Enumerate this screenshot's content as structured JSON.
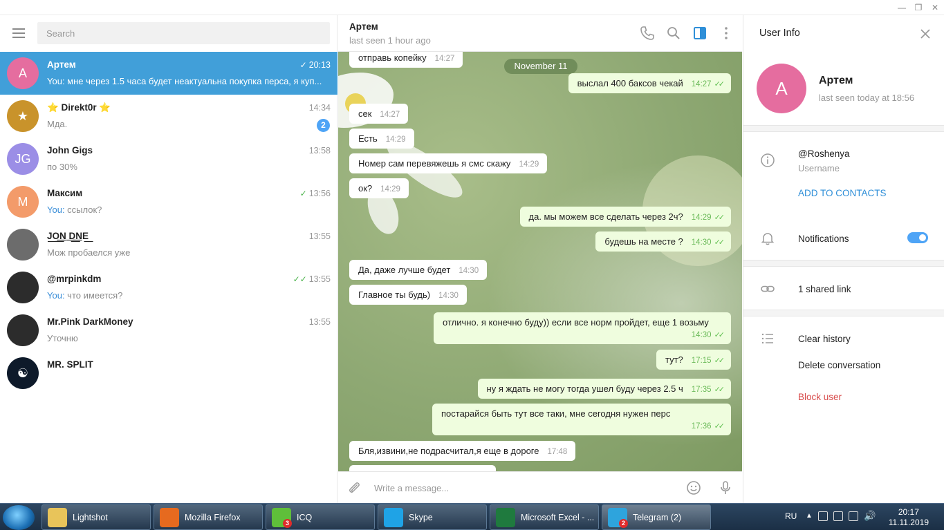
{
  "window": {
    "minimize": "—",
    "restore": "❐",
    "close": "✕"
  },
  "search": {
    "placeholder": "Search"
  },
  "chats": [
    {
      "name": "Артем",
      "time": "20:13",
      "you": "You:",
      "text": " мне через 1.5 часа будет неактуальна покупка перса, я куп...",
      "avatar": "A",
      "avatar_color": "#e56d9f",
      "read": "single"
    },
    {
      "name": "⭐ Direkt0r ⭐",
      "time": "14:34",
      "you": "",
      "text": "Мда.",
      "avatar": "★",
      "avatar_color": "#c9932b",
      "unread": "2"
    },
    {
      "name": "John Gigs",
      "time": "13:58",
      "you": "",
      "text": "по 30%",
      "avatar": "JG",
      "avatar_color": "#9b8ee6"
    },
    {
      "name": "Максим",
      "time": "13:56",
      "you": "You:",
      "text": " ссылок?",
      "avatar": "M",
      "avatar_color": "#f39b6a",
      "read": "single"
    },
    {
      "name": "J͟O͟͟N ͟D͟͟NE͟",
      "time": "13:55",
      "you": "",
      "text": "Мож пробаелся уже",
      "avatar": "",
      "avatar_color": "#6c6c6c"
    },
    {
      "name": "@mrpinkdm",
      "time": "13:55",
      "you": "You:",
      "text": " что имеется?",
      "avatar": "",
      "avatar_color": "#2c2c2c",
      "read": "double"
    },
    {
      "name": "Mr.Pink DarkMoney",
      "time": "13:55",
      "you": "",
      "text": "Уточню",
      "avatar": "",
      "avatar_color": "#2c2c2c"
    },
    {
      "name": "MR. SPLIT",
      "time": "",
      "you": "",
      "text": "",
      "avatar": "☯",
      "avatar_color": "#0e1a2a"
    }
  ],
  "chat_header": {
    "name": "Артем",
    "status": "last seen 1 hour ago"
  },
  "date_pill": "November 11",
  "messages": [
    {
      "dir": "in",
      "text": "отправь копейку",
      "time": "14:27"
    },
    {
      "dir": "out",
      "text": "выслал 400 баксов чекай",
      "time": "14:27"
    },
    {
      "dir": "in",
      "text": "сек",
      "time": "14:27"
    },
    {
      "dir": "in",
      "text": "Есть",
      "time": "14:29"
    },
    {
      "dir": "in",
      "text": "Номер сам перевяжешь я смс скажу",
      "time": "14:29"
    },
    {
      "dir": "in",
      "text": "ок?",
      "time": "14:29"
    },
    {
      "dir": "out",
      "text": "да. мы можем все сделать через 2ч?",
      "time": "14:29"
    },
    {
      "dir": "out",
      "text": "будешь на месте ?",
      "time": "14:30"
    },
    {
      "dir": "in",
      "text": "Да, даже лучше будет",
      "time": "14:30"
    },
    {
      "dir": "in",
      "text": "Главное ты будь)",
      "time": "14:30"
    },
    {
      "dir": "out",
      "text": "отлично. я конечно буду)) если все норм пройдет, еще 1 возьму",
      "time": "14:30"
    },
    {
      "dir": "out",
      "text": "тут?",
      "time": "17:15"
    },
    {
      "dir": "out",
      "text": "ну я ждать не могу тогда ушел буду через 2.5 ч",
      "time": "17:35"
    },
    {
      "dir": "out",
      "text": "постарайся быть тут все таки, мне сегодня нужен перс",
      "time": "17:36"
    },
    {
      "dir": "in",
      "text": "Бля,извини,не подрасчитал,я еще в дороге",
      "time": "17:48"
    }
  ],
  "composer": {
    "placeholder": "Write a message..."
  },
  "user_info": {
    "title": "User Info",
    "avatar": "A",
    "name": "Артем",
    "last_seen": "last seen today at 18:56",
    "username": "@Roshenya",
    "username_label": "Username",
    "add_contact": "ADD TO CONTACTS",
    "notifications": "Notifications",
    "notifications_on": true,
    "shared_links": "1 shared link",
    "clear_history": "Clear history",
    "delete_conversation": "Delete conversation",
    "block_user": "Block user"
  },
  "taskbar": {
    "apps": [
      {
        "label": "Lightshot",
        "icon": "folder-icon",
        "color": "#e8c45a",
        "badge": ""
      },
      {
        "label": "Mozilla Firefox",
        "icon": "firefox-icon",
        "color": "#e66a1f",
        "badge": ""
      },
      {
        "label": "ICQ",
        "icon": "icq-icon",
        "color": "#5fbf3a",
        "badge": "3"
      },
      {
        "label": "Skype",
        "icon": "skype-icon",
        "color": "#1fa3e6",
        "badge": ""
      },
      {
        "label": "Microsoft Excel - ...",
        "icon": "excel-icon",
        "color": "#1f7a3e",
        "badge": ""
      },
      {
        "label": "Telegram (2)",
        "icon": "telegram-icon",
        "color": "#2ea4dd",
        "badge": "2"
      }
    ],
    "language": "RU",
    "time": "20:17",
    "date": "11.11.2019"
  }
}
